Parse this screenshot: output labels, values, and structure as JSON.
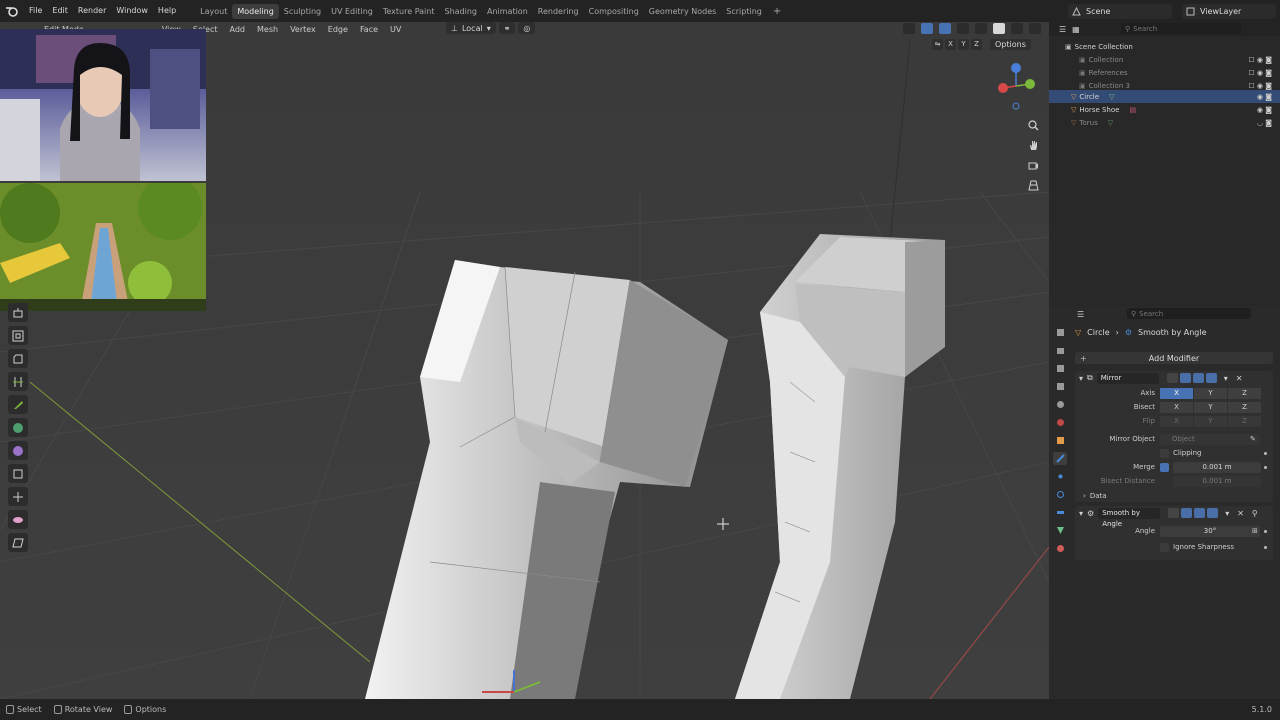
{
  "menus": [
    "File",
    "Edit",
    "Render",
    "Window",
    "Help"
  ],
  "workspaces": [
    "Layout",
    "Modeling",
    "Sculpting",
    "UV Editing",
    "Texture Paint",
    "Shading",
    "Animation",
    "Rendering",
    "Compositing",
    "Geometry Nodes",
    "Scripting"
  ],
  "active_workspace": "Modeling",
  "workspace_add": "+",
  "scene": "Scene",
  "view_layer": "ViewLayer",
  "viewport": {
    "mode": "Edit Mode",
    "menus": [
      "View",
      "Select",
      "Add",
      "Mesh",
      "Vertex",
      "Edge",
      "Face",
      "UV"
    ],
    "transform_orientation": "Local",
    "axes": [
      "X",
      "Y",
      "Z"
    ],
    "options_label": "Options"
  },
  "outliner": {
    "search_placeholder": "Search",
    "root": "Scene Collection",
    "rows": [
      {
        "name": "Collection",
        "dim": true
      },
      {
        "name": "References",
        "dim": true
      },
      {
        "name": "Collection 3",
        "dim": true
      },
      {
        "name": "Circle",
        "selected": true
      },
      {
        "name": "Horse Shoe",
        "dim": false
      },
      {
        "name": "Torus",
        "dim": true
      }
    ]
  },
  "properties": {
    "search_placeholder": "Search",
    "breadcrumb_object": "Circle",
    "breadcrumb_modifier": "Smooth by Angle",
    "add_modifier": "Add Modifier",
    "mirror": {
      "name": "Mirror",
      "axis_label": "Axis",
      "bisect_label": "Bisect",
      "flip_label": "Flip",
      "x": "X",
      "y": "Y",
      "z": "Z",
      "mirror_object_label": "Mirror Object",
      "mirror_object_placeholder": "Object",
      "clipping": "Clipping",
      "merge_label": "Merge",
      "merge_value": "0.001 m",
      "bisect_distance_label": "Bisect Distance",
      "bisect_distance_value": "0.001 m",
      "data_label": "Data"
    },
    "smooth": {
      "name": "Smooth by Angle",
      "angle_label": "Angle",
      "angle_value": "30°",
      "ignore_sharpness": "Ignore Sharpness"
    }
  },
  "status": {
    "select": "Select",
    "rotate_view": "Rotate View",
    "options": "Options",
    "version": "5.1.0"
  },
  "colors": {
    "accent": "#4772b3",
    "selected_row": "#344c75",
    "viewport_bg": "#3b3b3b"
  }
}
